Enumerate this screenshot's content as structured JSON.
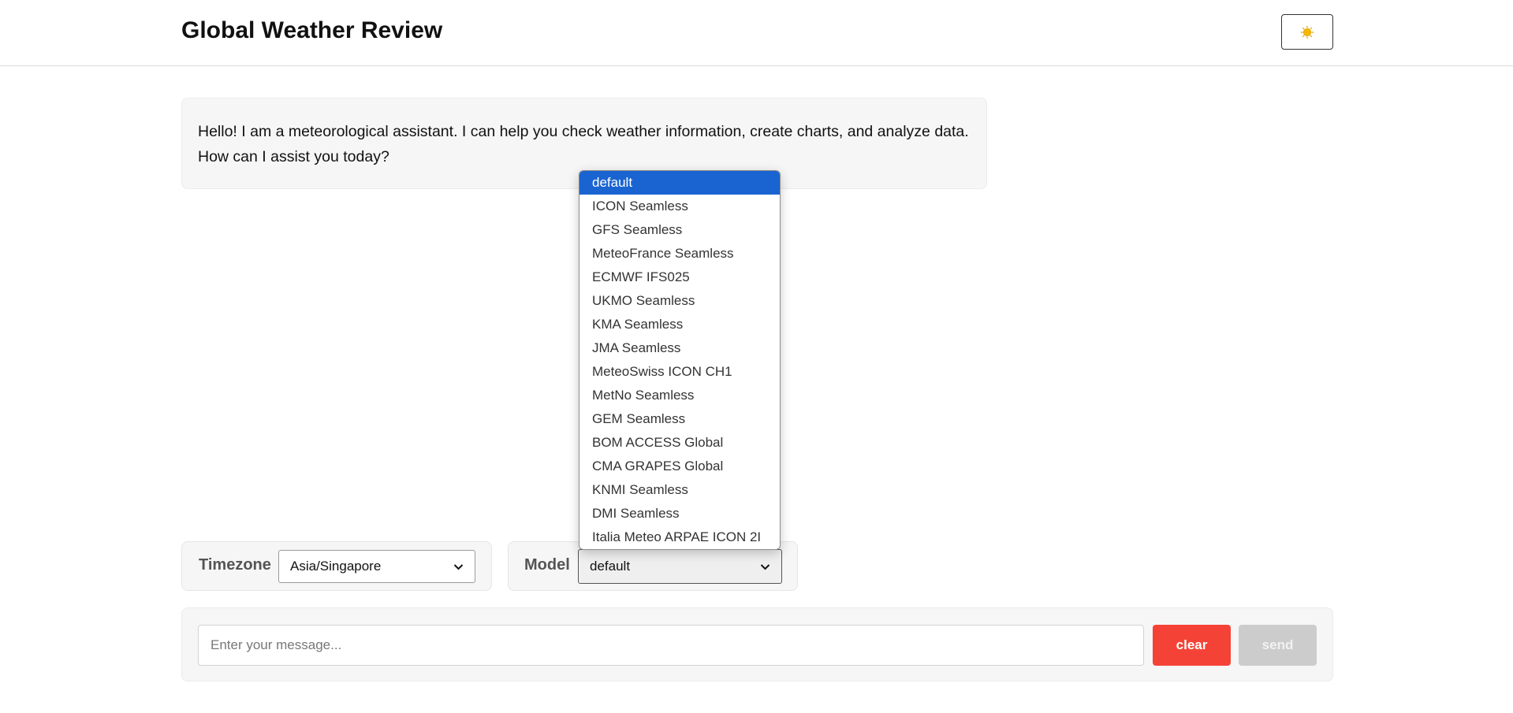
{
  "header": {
    "title": "Global Weather Review",
    "theme_toggle_icon": "sun-icon",
    "sun_color": "#f5b700"
  },
  "chat": {
    "assistant_message": "Hello! I am a meteorological assistant. I can help you check weather information, create charts, and analyze data. How can I assist you today?"
  },
  "controls": {
    "timezone": {
      "label": "Timezone",
      "selected": "Asia/Singapore"
    },
    "model": {
      "label": "Model",
      "selected": "default",
      "options": [
        "default",
        "ICON Seamless",
        "GFS Seamless",
        "MeteoFrance Seamless",
        "ECMWF IFS025",
        "UKMO Seamless",
        "KMA Seamless",
        "JMA Seamless",
        "MeteoSwiss ICON CH1",
        "MetNo Seamless",
        "GEM Seamless",
        "BOM ACCESS Global",
        "CMA GRAPES Global",
        "KNMI Seamless",
        "DMI Seamless",
        "Italia Meteo ARPAE ICON 2I"
      ]
    }
  },
  "composer": {
    "placeholder": "Enter your message...",
    "clear_label": "clear",
    "send_label": "send"
  },
  "colors": {
    "clear_button": "#f44336",
    "send_button_disabled": "#cccccc",
    "dropdown_highlight": "#1a64d1"
  }
}
